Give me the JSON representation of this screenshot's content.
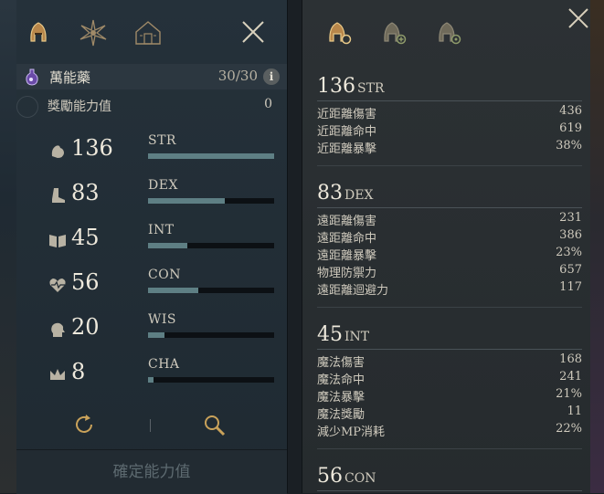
{
  "left_panel": {
    "potion": {
      "name": "萬能藥",
      "count": "30/30",
      "info": "i"
    },
    "bonus": {
      "label": "獎勵能力值",
      "value": "0"
    },
    "stats": [
      {
        "abbr": "STR",
        "value": "136",
        "fill": 1.0,
        "icon": "arm-icon"
      },
      {
        "abbr": "DEX",
        "value": "83",
        "fill": 0.61,
        "icon": "boot-icon"
      },
      {
        "abbr": "INT",
        "value": "45",
        "fill": 0.31,
        "icon": "book-icon"
      },
      {
        "abbr": "CON",
        "value": "56",
        "fill": 0.4,
        "icon": "heart-icon"
      },
      {
        "abbr": "WIS",
        "value": "20",
        "fill": 0.13,
        "icon": "head-icon"
      },
      {
        "abbr": "CHA",
        "value": "8",
        "fill": 0.04,
        "icon": "crown-icon"
      }
    ],
    "confirm_label": "確定能力值"
  },
  "right_panel": {
    "sections": [
      {
        "value": "136",
        "abbr": "STR",
        "items": [
          {
            "label": "近距離傷害",
            "value": "436"
          },
          {
            "label": "近距離命中",
            "value": "619"
          },
          {
            "label": "近距離暴擊",
            "value": "38%"
          }
        ]
      },
      {
        "value": "83",
        "abbr": "DEX",
        "items": [
          {
            "label": "遠距離傷害",
            "value": "231"
          },
          {
            "label": "遠距離命中",
            "value": "386"
          },
          {
            "label": "遠距離暴擊",
            "value": "23%"
          },
          {
            "label": "物理防禦力",
            "value": "657"
          },
          {
            "label": "遠距離迴避力",
            "value": "117"
          }
        ]
      },
      {
        "value": "45",
        "abbr": "INT",
        "items": [
          {
            "label": "魔法傷害",
            "value": "168"
          },
          {
            "label": "魔法命中",
            "value": "241"
          },
          {
            "label": "魔法暴擊",
            "value": "21%"
          },
          {
            "label": "魔法獎勵",
            "value": "11"
          },
          {
            "label": "減少MP消耗",
            "value": "22%"
          }
        ]
      },
      {
        "value": "56",
        "abbr": "CON",
        "items": []
      }
    ]
  },
  "colors": {
    "accent": "#c9a25a",
    "bar_fill": "#5e7f84",
    "bar_bg": "#0c1014"
  }
}
